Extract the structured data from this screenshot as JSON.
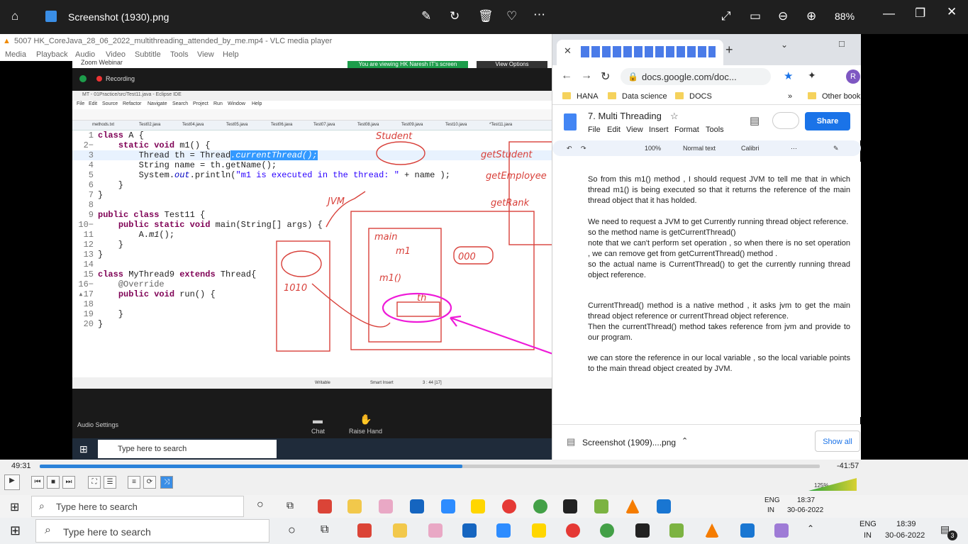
{
  "photos": {
    "title": "Screenshot (1930).png",
    "zoom": "88%"
  },
  "vlc": {
    "title": "5007 HK_CoreJava_28_06_2022_multithreading_attended_by_me.mp4 - VLC media player",
    "menu": [
      "Media",
      "Playback",
      "Audio",
      "Video",
      "Subtitle",
      "Tools",
      "View",
      "Help"
    ],
    "elapsed": "49:31",
    "remaining": "-41:57",
    "progress": 0.542,
    "volume": "125%"
  },
  "zoom": {
    "title": "Zoom Webinar",
    "viewing": "You are viewing HK Naresh IT's screen",
    "view_options": "View Options",
    "recording": "Recording",
    "audio_settings": "Audio Settings",
    "chat": "Chat",
    "raise_hand": "Raise Hand"
  },
  "eclipse": {
    "title": "MT - 01Practice/src/Test11.java - Eclipse IDE",
    "menu": [
      "File",
      "Edit",
      "Source",
      "Refactor",
      "Navigate",
      "Search",
      "Project",
      "Run",
      "Window",
      "Help"
    ],
    "tabs": [
      "methods.txt",
      "Test02.java",
      "Test04.java",
      "Test05.java",
      "Test06.java",
      "Test07.java",
      "Test08.java",
      "Test09.java",
      "Test10.java",
      "*Test11.java"
    ],
    "status": [
      "Writable",
      "Smart Insert",
      "3 : 44 [17]"
    ]
  },
  "code": [
    {
      "n": "1",
      "t": "class A {"
    },
    {
      "n": "2−",
      "t": "    static void m1() {"
    },
    {
      "n": "3",
      "t": "        Thread th = Thread.currentThread();"
    },
    {
      "n": "4",
      "t": "        String name = th.getName();"
    },
    {
      "n": "5",
      "t": "        System.out.println(\"m1 is executed in the thread: \" + name );"
    },
    {
      "n": "6",
      "t": "    }"
    },
    {
      "n": "7",
      "t": "}"
    },
    {
      "n": "8",
      "t": ""
    },
    {
      "n": "9",
      "t": "public class Test11 {"
    },
    {
      "n": "10−",
      "t": "    public static void main(String[] args) {"
    },
    {
      "n": "11",
      "t": "        A.m1();"
    },
    {
      "n": "12",
      "t": "    }"
    },
    {
      "n": "13",
      "t": "}"
    },
    {
      "n": "14",
      "t": ""
    },
    {
      "n": "15",
      "t": "class MyThread9 extends Thread{"
    },
    {
      "n": "16−",
      "t": "    @Override"
    },
    {
      "n": "▴17",
      "t": "    public void run() {"
    },
    {
      "n": "18",
      "t": ""
    },
    {
      "n": "19",
      "t": "    }"
    },
    {
      "n": "20",
      "t": "}"
    }
  ],
  "handwriting": [
    "Student",
    "getStudent",
    "getEmployee",
    "getRank",
    "JVM",
    "main",
    "m1",
    "m1()",
    "000",
    "1010",
    "th"
  ],
  "chrome": {
    "url": "docs.google.com/doc...",
    "bookmarks": [
      "HANA",
      "Data science",
      "DOCS",
      "Other book"
    ],
    "download": "Screenshot (1909)....png",
    "show_all": "Show all"
  },
  "docs": {
    "title": "7. Multi Threading",
    "menu": [
      "File",
      "Edit",
      "View",
      "Insert",
      "Format",
      "Tools"
    ],
    "share": "Share",
    "zoom": "100%",
    "style": "Normal text",
    "font": "Calibri",
    "paragraphs": [
      "So from this m1() method , I should request JVM to tell me that in which thread m1() is being executed so that it returns the reference of the main thread object that it has holded.",
      "We need to request a JVM to get Currently running thread object reference.\nso the method name is getCurrentThread()\nnote that we can't perform set operation , so when there is no set operation , we can remove get from getCurrentThread() method .\nso the actual name is CurrentThread() to get the currently running thread object reference.",
      "CurrentThread() method is a native method , it asks jvm to get the main thread object reference or currentThread object reference.\nThen the currentThread() method takes reference from jvm and provide to our program.",
      "we can store the reference in our local variable , so the local variable points to the main thread object created by JVM."
    ]
  },
  "taskbar": {
    "search": "Type here to search",
    "lang": "ENG",
    "region": "IN",
    "time1": "18:37",
    "time2": "18:39",
    "date": "30-06-2022",
    "notif": "3"
  }
}
